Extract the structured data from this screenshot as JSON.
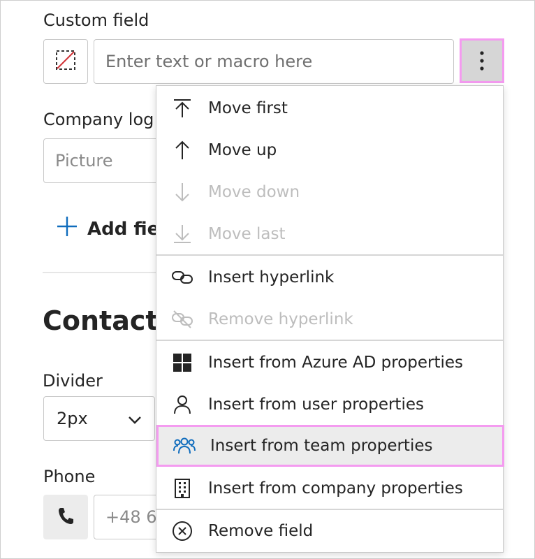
{
  "form": {
    "custom_field_label": "Custom field",
    "custom_field_placeholder": "Enter text or macro here",
    "company_logo_label": "Company log",
    "picture_placeholder": "Picture",
    "add_field_label": "Add fiel",
    "contact_title": "Contact c",
    "divider_label": "Divider",
    "divider_value": "2px",
    "phone_label": "Phone",
    "phone_value": "+48 6"
  },
  "menu": {
    "items": [
      {
        "label": "Move first",
        "icon": "move-first-icon",
        "enabled": true
      },
      {
        "label": "Move up",
        "icon": "arrow-up-icon",
        "enabled": true
      },
      {
        "label": "Move down",
        "icon": "arrow-down-icon",
        "enabled": false
      },
      {
        "label": "Move last",
        "icon": "move-last-icon",
        "enabled": false
      },
      {
        "label": "Insert hyperlink",
        "icon": "link-icon",
        "enabled": true
      },
      {
        "label": "Remove hyperlink",
        "icon": "link-remove-icon",
        "enabled": false
      },
      {
        "label": "Insert from Azure AD properties",
        "icon": "azure-grid-icon",
        "enabled": true
      },
      {
        "label": "Insert from user properties",
        "icon": "person-icon",
        "enabled": true
      },
      {
        "label": "Insert from team properties",
        "icon": "people-team-icon",
        "enabled": true,
        "highlighted": true
      },
      {
        "label": "Insert from company properties",
        "icon": "building-icon",
        "enabled": true
      },
      {
        "label": "Remove field",
        "icon": "dismiss-circle-icon",
        "enabled": true
      }
    ]
  },
  "colors": {
    "accent": "#0f6cbd",
    "highlight_border": "#f49bf0",
    "disabled_text": "#bdbdbd"
  }
}
